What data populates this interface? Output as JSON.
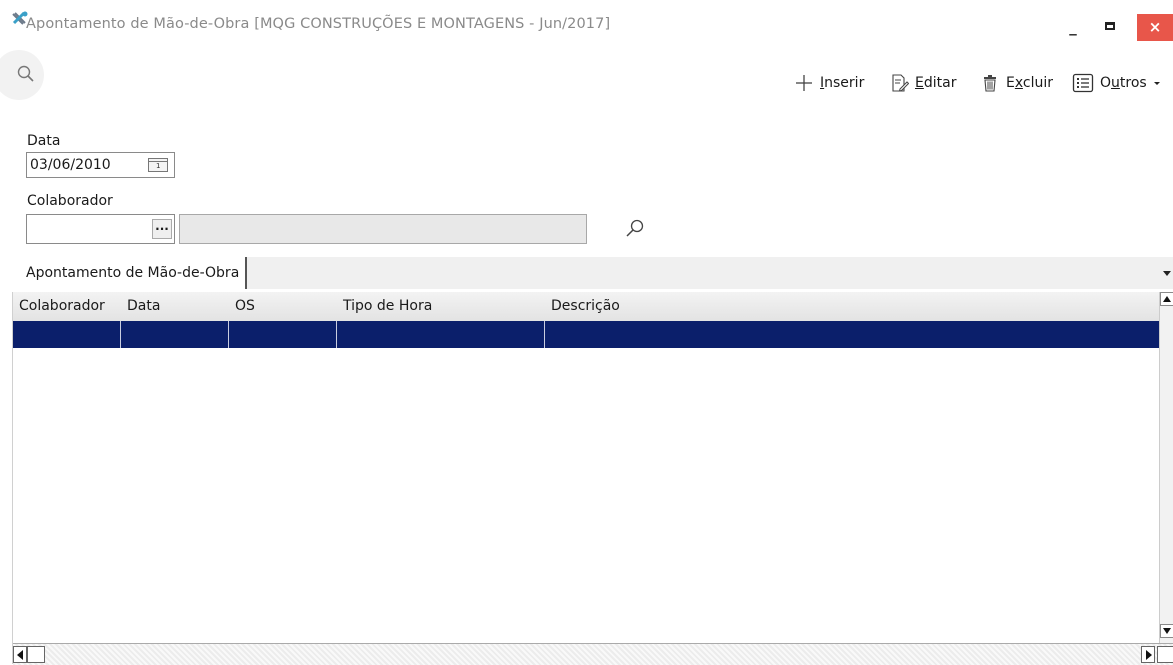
{
  "window": {
    "title": "Apontamento de Mão-de-Obra [MQG CONSTRUÇÕES E MONTAGENS - Jun/2017]",
    "minimize": "_",
    "close": "×"
  },
  "toolbar": {
    "inserir": {
      "prefix": "",
      "key": "I",
      "rest": "nserir"
    },
    "editar": {
      "prefix": "",
      "key": "E",
      "rest": "ditar"
    },
    "excluir": {
      "prefix": "E",
      "key": "x",
      "rest": "cluir"
    },
    "outros": {
      "prefix": "O",
      "key": "u",
      "rest": "tros"
    }
  },
  "form": {
    "data_label": "Data",
    "data_value": "03/06/2010",
    "calendar_day": "1",
    "colaborador_label": "Colaborador",
    "colaborador_code": "",
    "colaborador_name": "",
    "ellipsis": "..."
  },
  "tabs": [
    {
      "label": "Apontamento de Mão-de-Obra"
    }
  ],
  "grid": {
    "columns": [
      "Colaborador",
      "Data",
      "OS",
      "Tipo de Hora",
      "Descrição"
    ],
    "selected_row": [
      "",
      "",
      "",
      "",
      ""
    ]
  },
  "colors": {
    "selection": "#0b1f6b",
    "close_button": "#e8564a",
    "title_text": "#8a8a8a"
  }
}
